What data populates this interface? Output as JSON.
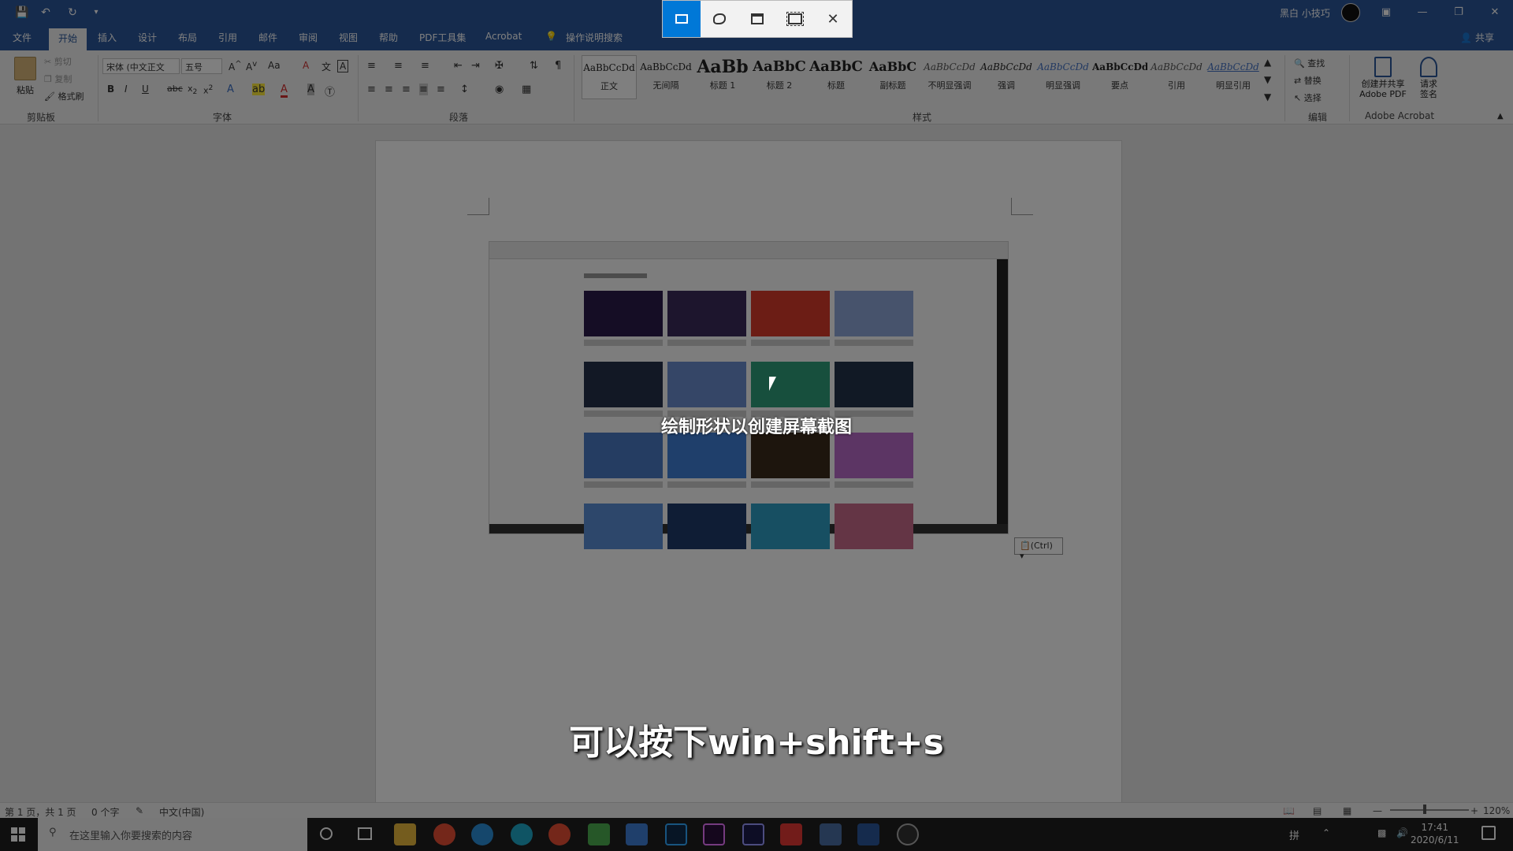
{
  "titlebar": {
    "qat_icons": [
      "save-icon",
      "undo-icon",
      "redo-icon",
      "customize-icon"
    ],
    "user_name": "黑白 小技巧"
  },
  "snip_toolbar": {
    "tools": [
      "rectangular-snip",
      "freeform-snip",
      "window-snip",
      "fullscreen-snip",
      "close-snip"
    ],
    "active": "rectangular-snip"
  },
  "tabs": [
    "文件",
    "开始",
    "插入",
    "设计",
    "布局",
    "引用",
    "邮件",
    "审阅",
    "视图",
    "帮助",
    "PDF工具集",
    "Acrobat"
  ],
  "active_tab": "开始",
  "tell_me": "操作说明搜索",
  "share": "共享",
  "ribbon": {
    "clipboard": {
      "paste": "粘贴",
      "cut": "剪切",
      "copy": "复制",
      "format_painter": "格式刷",
      "label": "剪贴板"
    },
    "font": {
      "face": "宋体 (中文正文",
      "size": "五号",
      "label": "字体"
    },
    "paragraph": {
      "label": "段落"
    },
    "styles": {
      "label": "样式",
      "items": [
        {
          "sample": "AaBbCcDd",
          "name": "正文"
        },
        {
          "sample": "AaBbCcDd",
          "name": "无间隔"
        },
        {
          "sample": "AaBb",
          "name": "标题 1"
        },
        {
          "sample": "AaBbC",
          "name": "标题 2"
        },
        {
          "sample": "AaBbC",
          "name": "标题"
        },
        {
          "sample": "AaBbC",
          "name": "副标题"
        },
        {
          "sample": "AaBbCcDd",
          "name": "不明显强调"
        },
        {
          "sample": "AaBbCcDd",
          "name": "强调"
        },
        {
          "sample": "AaBbCcDd",
          "name": "明显强调"
        },
        {
          "sample": "AaBbCcDd",
          "name": "要点"
        },
        {
          "sample": "AaBbCcDd",
          "name": "引用"
        },
        {
          "sample": "AaBbCcDd",
          "name": "明显引用"
        }
      ]
    },
    "editing": {
      "find": "查找",
      "replace": "替换",
      "select": "选择",
      "label": "编辑"
    },
    "acrobat": {
      "create_share": "创建并共享 Adobe PDF",
      "request_sign": "请求 签名",
      "label": "Adobe Acrobat"
    }
  },
  "document": {
    "paste_options": "(Ctrl)",
    "snip_hint": "绘制形状以创建屏幕截图",
    "subtitle": "可以按下win+shift+s"
  },
  "statusbar": {
    "page": "第 1 页，共 1 页",
    "words": "0 个字",
    "language": "中文(中国)",
    "zoom": "120%"
  },
  "taskbar": {
    "search_placeholder": "在这里输入你要搜索的内容",
    "time": "17:41",
    "date": "2020/6/11",
    "input_method": "拼"
  }
}
